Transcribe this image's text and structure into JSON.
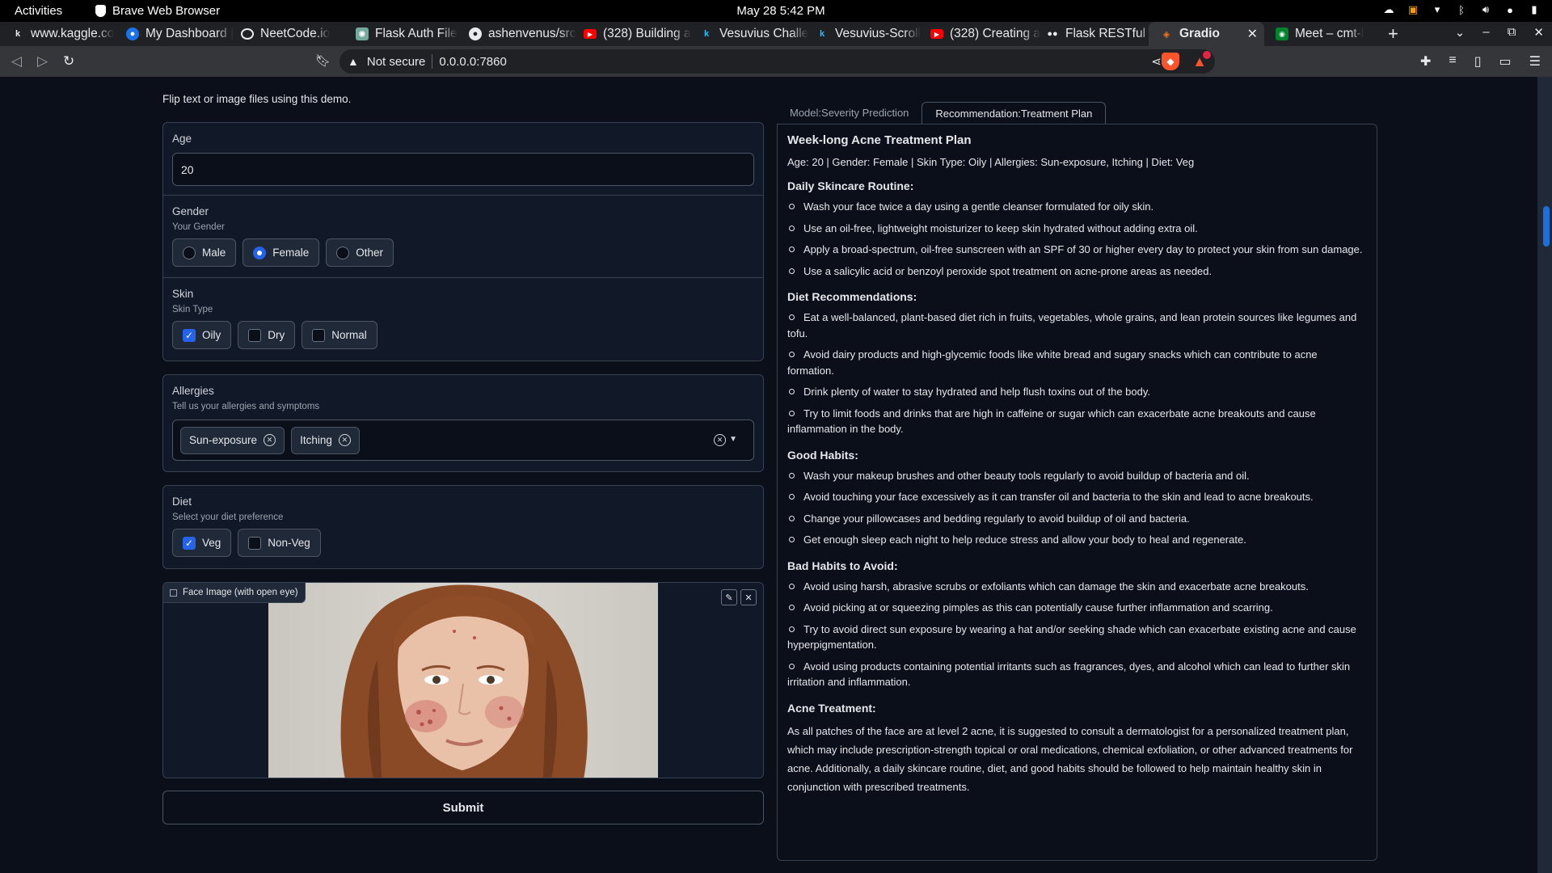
{
  "os": {
    "activities": "Activities",
    "app_name": "Brave Web Browser",
    "clock": "May 28  5:42 PM"
  },
  "tabs": [
    {
      "title": "www.kaggle.co",
      "favicon": "kaggle-icon"
    },
    {
      "title": "My Dashboard |",
      "favicon": "dashboard-icon"
    },
    {
      "title": "NeetCode.io",
      "favicon": "neetcode-icon"
    },
    {
      "title": "Flask Auth File",
      "favicon": "chatgpt-icon"
    },
    {
      "title": "ashenvenus/src",
      "favicon": "github-icon"
    },
    {
      "title": "(328) Building a",
      "favicon": "youtube-icon"
    },
    {
      "title": "Vesuvius Challe",
      "favicon": "kaggle-icon"
    },
    {
      "title": "Vesuvius-Scroll",
      "favicon": "kaggle-icon"
    },
    {
      "title": "(328) Creating a",
      "favicon": "youtube-icon"
    },
    {
      "title": "Flask RESTful C",
      "favicon": "flask-icon"
    },
    {
      "title": "Gradio",
      "favicon": "gradio-icon",
      "active": true
    },
    {
      "title": "Meet – cmt-l",
      "favicon": "meet-icon"
    }
  ],
  "addressbar": {
    "security": "Not secure",
    "url": "0.0.0.0:7860"
  },
  "page": {
    "description": "Flip text or image files using this demo.",
    "age": {
      "label": "Age",
      "value": "20"
    },
    "gender": {
      "label": "Gender",
      "info": "Your Gender",
      "options": [
        "Male",
        "Female",
        "Other"
      ],
      "selected": "Female"
    },
    "skin": {
      "label": "Skin",
      "info": "Skin Type",
      "options": [
        "Oily",
        "Dry",
        "Normal"
      ],
      "checked": [
        "Oily"
      ]
    },
    "allergies": {
      "label": "Allergies",
      "info": "Tell us your allergies and symptoms",
      "selected": [
        "Sun-exposure",
        "Itching"
      ]
    },
    "diet": {
      "label": "Diet",
      "info": "Select your diet preference",
      "options": [
        "Veg",
        "Non-Veg"
      ],
      "checked": [
        "Veg"
      ]
    },
    "image": {
      "label": "Face Image (with open eye)"
    },
    "submit_label": "Submit"
  },
  "output": {
    "tabs": [
      "Model:Severity Prediction",
      "Recommendation:Treatment Plan"
    ],
    "active_tab": "Recommendation:Treatment Plan",
    "title": "Week-long Acne Treatment Plan",
    "meta": "Age: 20 | Gender: Female | Skin Type: Oily | Allergies: Sun-exposure, Itching | Diet: Veg",
    "sections": [
      {
        "heading": "Daily Skincare Routine:",
        "items": [
          "Wash your face twice a day using a gentle cleanser formulated for oily skin.",
          "Use an oil-free, lightweight moisturizer to keep skin hydrated without adding extra oil.",
          "Apply a broad-spectrum, oil-free sunscreen with an SPF of 30 or higher every day to protect your skin from sun damage.",
          "Use a salicylic acid or benzoyl peroxide spot treatment on acne-prone areas as needed."
        ]
      },
      {
        "heading": "Diet Recommendations:",
        "items": [
          "Eat a well-balanced, plant-based diet rich in fruits, vegetables, whole grains, and lean protein sources like legumes and tofu.",
          "Avoid dairy products and high-glycemic foods like white bread and sugary snacks which can contribute to acne formation.",
          "Drink plenty of water to stay hydrated and help flush toxins out of the body.",
          "Try to limit foods and drinks that are high in caffeine or sugar which can exacerbate acne breakouts and cause inflammation in the body."
        ]
      },
      {
        "heading": "Good Habits:",
        "items": [
          "Wash your makeup brushes and other beauty tools regularly to avoid buildup of bacteria and oil.",
          "Avoid touching your face excessively as it can transfer oil and bacteria to the skin and lead to acne breakouts.",
          "Change your pillowcases and bedding regularly to avoid buildup of oil and bacteria.",
          "Get enough sleep each night to help reduce stress and allow your body to heal and regenerate."
        ]
      },
      {
        "heading": "Bad Habits to Avoid:",
        "items": [
          "Avoid using harsh, abrasive scrubs or exfoliants which can damage the skin and exacerbate acne breakouts.",
          "Avoid picking at or squeezing pimples as this can potentially cause further inflammation and scarring.",
          "Try to avoid direct sun exposure by wearing a hat and/or seeking shade which can exacerbate existing acne and cause hyperpigmentation.",
          "Avoid using products containing potential irritants such as fragrances, dyes, and alcohol which can lead to further skin irritation and inflammation."
        ]
      }
    ],
    "treatment_heading": "Acne Treatment:",
    "treatment_text": "As all patches of the face are at level 2 acne, it is suggested to consult a dermatologist for a personalized treatment plan, which may include prescription-strength topical or oral medications, chemical exfoliation, or other advanced treatments for acne. Additionally, a daily skincare routine, diet, and good habits should be followed to help maintain healthy skin in conjunction with prescribed treatments."
  },
  "colors": {
    "accent": "#2563eb",
    "background": "#0b0f19",
    "panel": "#111827",
    "brave": "#fb542b"
  }
}
